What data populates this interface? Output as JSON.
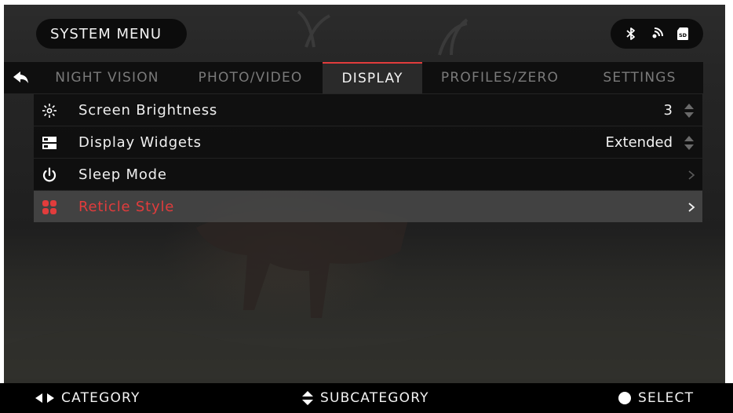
{
  "header": {
    "title": "SYSTEM MENU",
    "status_icons": [
      "bluetooth-icon",
      "wifi-icon",
      "sd-card-icon"
    ]
  },
  "tabs": [
    {
      "label": "NIGHT VISION",
      "active": false
    },
    {
      "label": "PHOTO/VIDEO",
      "active": false
    },
    {
      "label": "DISPLAY",
      "active": true
    },
    {
      "label": "PROFILES/ZERO",
      "active": false
    },
    {
      "label": "SETTINGS",
      "active": false
    }
  ],
  "menu": {
    "items": [
      {
        "label": "Screen Brightness",
        "value": "3",
        "icon": "brightness-icon",
        "control": "spinner"
      },
      {
        "label": "Display Widgets",
        "value": "Extended",
        "icon": "widgets-icon",
        "control": "spinner"
      },
      {
        "label": "Sleep Mode",
        "value": "",
        "icon": "power-icon",
        "control": "chevron"
      },
      {
        "label": "Reticle Style",
        "value": "",
        "icon": "reticle-icon",
        "control": "chevron",
        "selected": true
      }
    ]
  },
  "footer": {
    "category": "CATEGORY",
    "subcategory": "SUBCATEGORY",
    "select": "SELECT"
  },
  "colors": {
    "accent": "#e23c3c",
    "active_tab_bg": "#2a2a2a",
    "selected_row_bg": "#484848"
  }
}
